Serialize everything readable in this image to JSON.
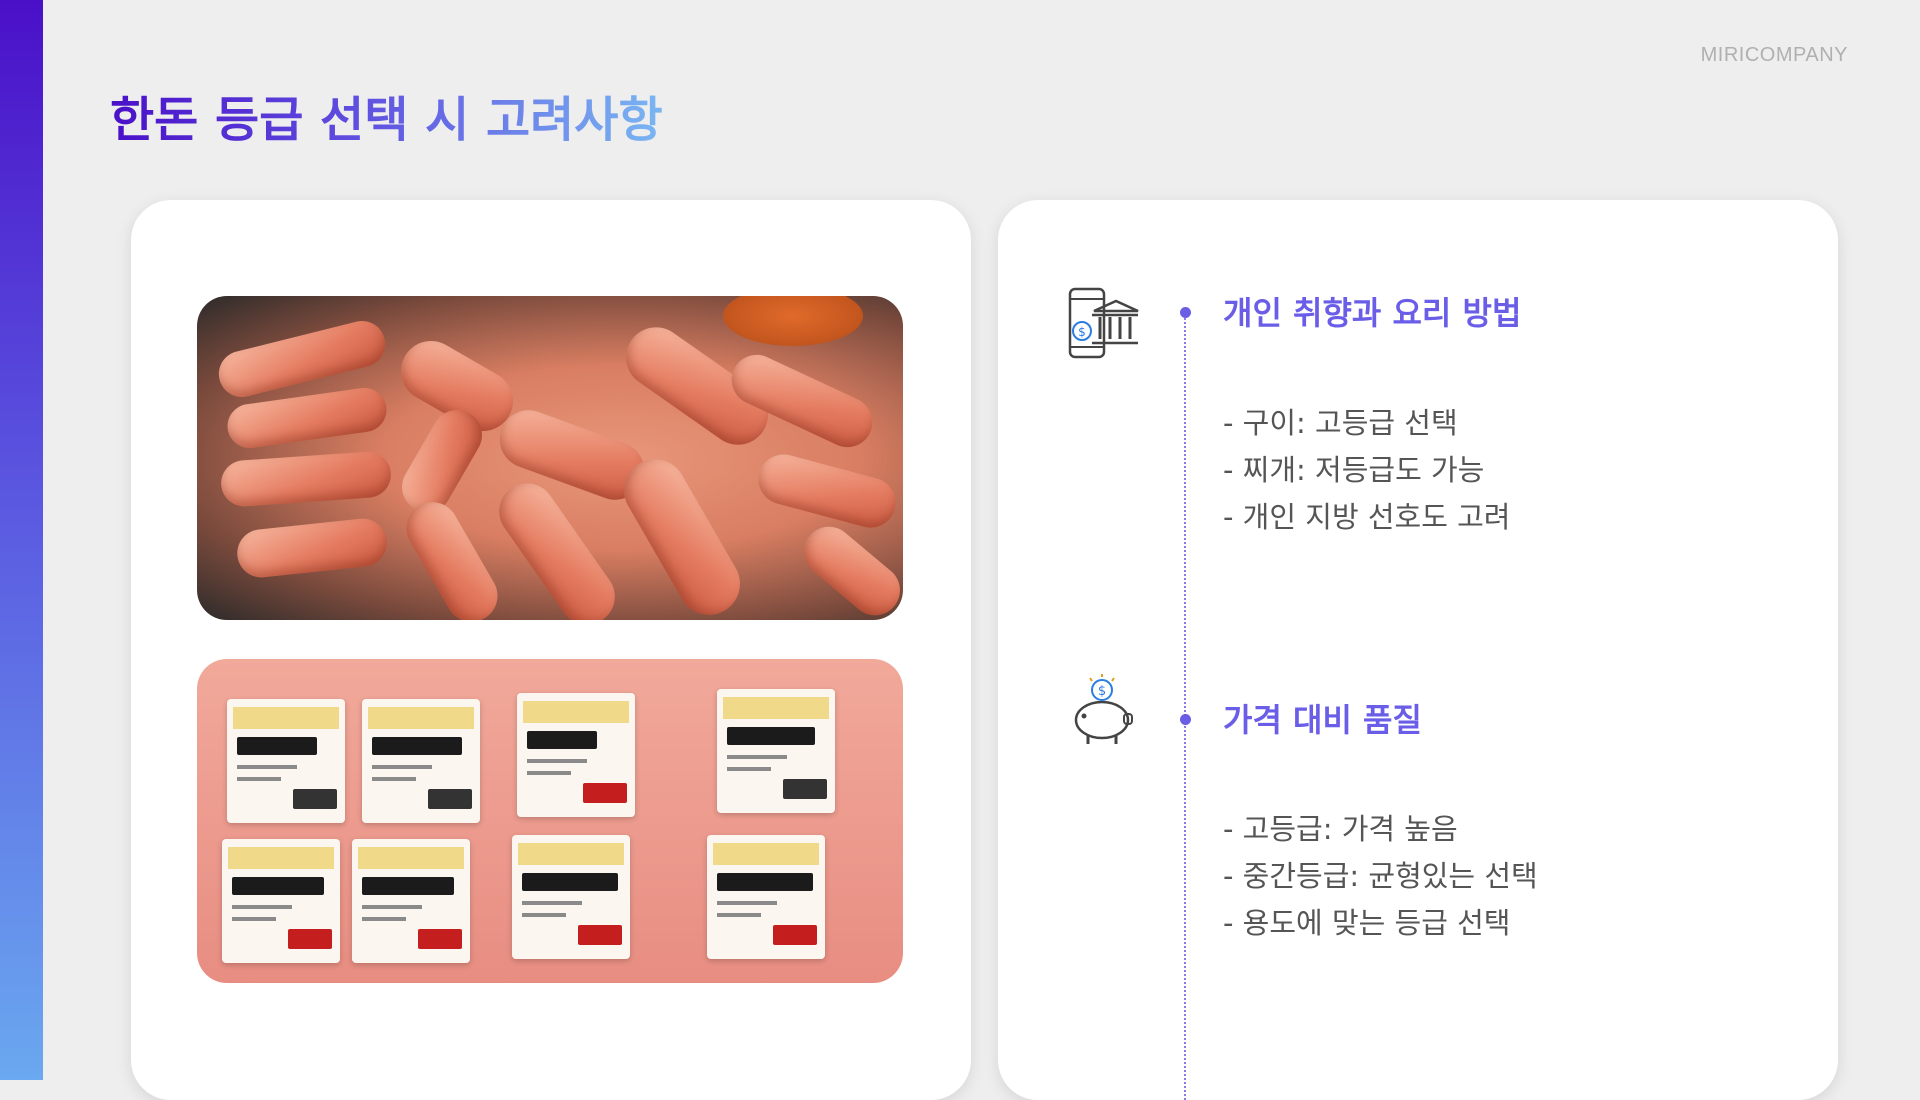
{
  "brand": "MIRICOMPANY",
  "title": "한돈 등급 선택 시 고려사항",
  "colors": {
    "accent_purple": "#4a10c8",
    "accent_blue": "#7ab6f2",
    "heading": "#6a5de8",
    "text": "#555555"
  },
  "images": [
    {
      "name": "grilled-pork-photo",
      "description_icon": "photo"
    },
    {
      "name": "pork-price-tags-photo",
      "description_icon": "photo"
    }
  ],
  "sections": [
    {
      "icon": "mobile-banking-icon",
      "heading": "개인 취향과 요리 방법",
      "items": [
        "- 구이: 고등급 선택",
        "- 찌개: 저등급도 가능",
        "- 개인 지방 선호도 고려"
      ]
    },
    {
      "icon": "piggy-bank-icon",
      "heading": "가격 대비 품질",
      "items": [
        "- 고등급: 가격 높음",
        "- 중간등급: 균형있는 선택",
        "- 용도에 맞는 등급 선택"
      ]
    }
  ]
}
